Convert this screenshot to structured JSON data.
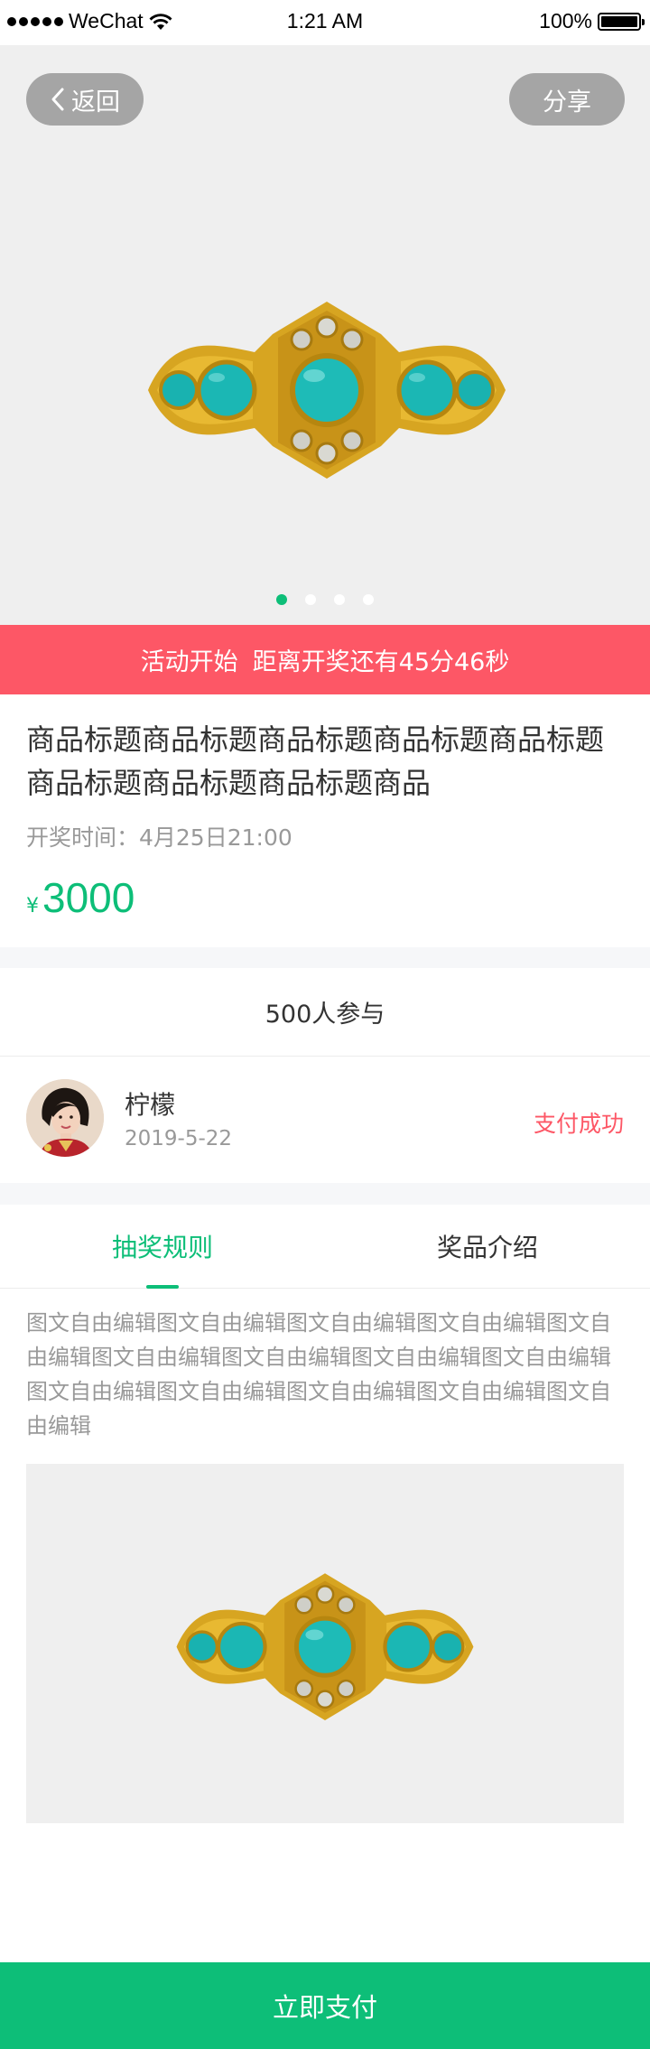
{
  "status_bar": {
    "carrier": "WeChat",
    "time": "1:21 AM",
    "battery": "100%"
  },
  "hero": {
    "back_label": "返回",
    "share_label": "分享",
    "carousel_index": 1,
    "carousel_count": 4
  },
  "banner": {
    "start_text": "活动开始",
    "countdown_text": "距离开奖还有45分46秒"
  },
  "product": {
    "title": "商品标题商品标题商品标题商品标题商品标题商品标题商品标题商品标题商品",
    "draw_time": "开奖时间：4月25日21:00",
    "currency": "¥",
    "price": "3000"
  },
  "participants": {
    "text": "500人参与"
  },
  "participant": {
    "name": "柠檬",
    "date": "2019-5-22",
    "status": "支付成功"
  },
  "tabs": [
    {
      "label": "抽奖规则",
      "active": true
    },
    {
      "label": "奖品介绍",
      "active": false
    }
  ],
  "description": "图文自由编辑图文自由编辑图文自由编辑图文自由编辑图文自由编辑图文自由编辑图文自由编辑图文自由编辑图文自由编辑图文自由编辑图文自由编辑图文自由编辑图文自由编辑图文自由编辑",
  "footer": {
    "pay_label": "立即支付"
  },
  "colors": {
    "accent_green": "#0dbe78",
    "banner_red": "#fd5766",
    "hero_bg": "#efefef",
    "pill_gray": "#a5a5a5"
  }
}
